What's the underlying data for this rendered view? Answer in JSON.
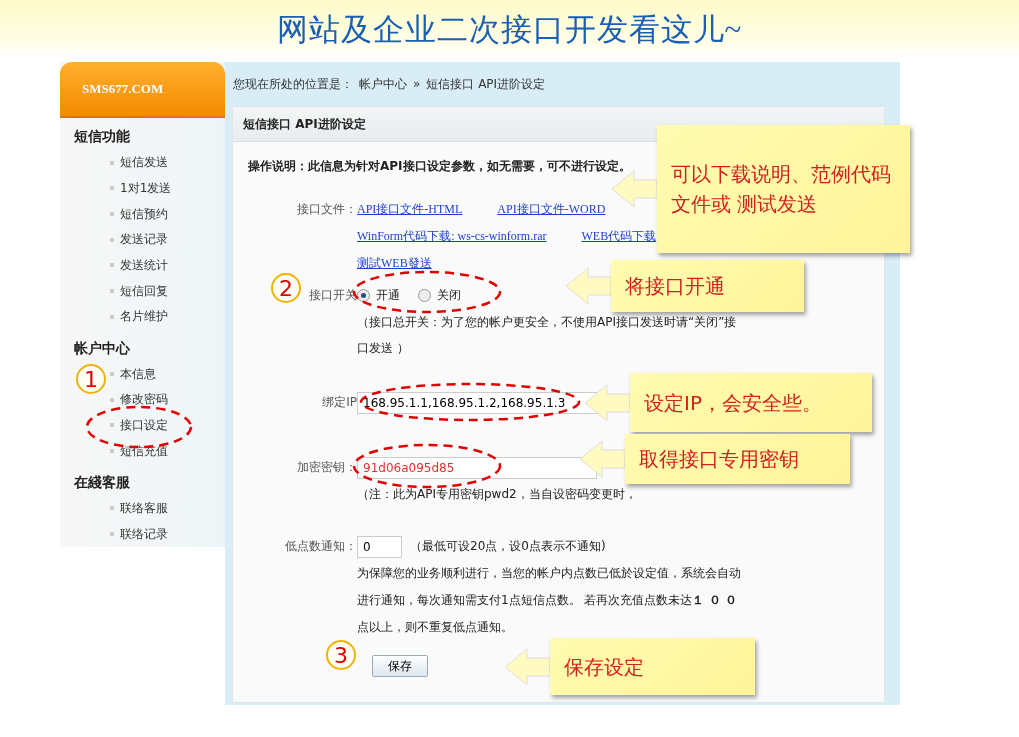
{
  "slide_title": "网站及企业二次接口开发看这儿~",
  "sidebar": {
    "logo": "SMS677.COM",
    "groups": [
      {
        "title": "短信功能",
        "items": [
          "短信发送",
          "1对1发送",
          "短信预约",
          "发送记录",
          "发送统计",
          "短信回复",
          "名片维护"
        ]
      },
      {
        "title": "帐户中心",
        "items": [
          "本信息",
          "修改密码",
          "接口设定",
          "短信充值"
        ]
      },
      {
        "title": "在綫客服",
        "items": [
          "联络客服",
          "联络记录"
        ]
      }
    ]
  },
  "breadcrumb": {
    "prefix": "您现在所处的位置是：",
    "items": [
      "帐户中心",
      "短信接口  API进阶设定"
    ],
    "separator": "»"
  },
  "panel": {
    "title": "短信接口  API进阶设定",
    "instructions": "操作说明：此信息为针对API接口设定参数，如无需要，可不进行设定。",
    "rows": [
      {
        "kind": "links",
        "label": "接口文件：",
        "link_rows": [
          [
            "API接口文件-HTML",
            "API接口文件-WORD"
          ],
          [
            "WinForm代码下载: ws-cs-winform.rar",
            "WEB代码下载"
          ],
          [
            "测試WEB發送"
          ]
        ]
      },
      {
        "kind": "radio",
        "label": "接口开关",
        "options": [
          {
            "label": "开通",
            "selected": true
          },
          {
            "label": "关闭",
            "selected": false
          }
        ],
        "note": "（接口总开关：为了您的帐户更安全，不使用API接口发送时请“关闭”接口发送 ）"
      },
      {
        "kind": "text",
        "label": "绑定IP",
        "value": "168.95.1.1,168.95.1.2,168.95.1.3"
      },
      {
        "kind": "key",
        "label": "加密密钥：",
        "value": "91d06a095d85",
        "note": "（注：此为API专用密钥pwd2，当自设密码变更时，"
      },
      {
        "kind": "number",
        "label": "低点数通知：",
        "value": "0",
        "hint": "（最低可设20点，设0点表示不通知)",
        "paragraph": "为保障您的业务顺利进行，当您的帐户内点数已低於设定值，系统会自动进行通知，每次通知需支付1点短信点数。 若再次充值点数未达**１ ０ ０**点以上，则不重复低点通知。"
      }
    ],
    "button": "保存"
  },
  "annotations": {
    "steps": [
      "1",
      "2",
      "3"
    ],
    "callouts": [
      "可以下载说明、范例代码文件或 测试发送",
      "将接口开通",
      "设定IP，会安全些。",
      "取得接口专用密钥",
      "保存设定"
    ]
  }
}
